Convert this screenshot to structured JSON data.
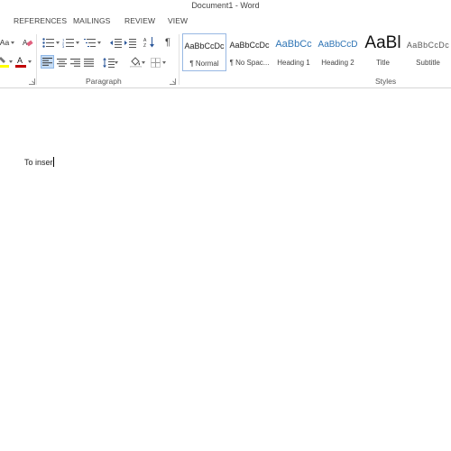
{
  "window": {
    "title": "Document1 - Word"
  },
  "tabs": [
    {
      "label": "REFERENCES"
    },
    {
      "label": "MAILINGS"
    },
    {
      "label": "REVIEW"
    },
    {
      "label": "VIEW"
    }
  ],
  "ribbon": {
    "font_group": {
      "change_case_label": "Aa"
    },
    "paragraph_group": {
      "label": "Paragraph",
      "active_alignment": "left"
    },
    "styles_group": {
      "label": "Styles",
      "items": [
        {
          "sample": "AaBbCcDc",
          "name": "¶ Normal",
          "selected": true,
          "color": "#222222"
        },
        {
          "sample": "AaBbCcDc",
          "name": "¶ No Spac...",
          "selected": false,
          "color": "#222222"
        },
        {
          "sample": "AaBbCc",
          "name": "Heading 1",
          "selected": false,
          "color": "#2e74b5"
        },
        {
          "sample": "AaBbCcD",
          "name": "Heading 2",
          "selected": false,
          "color": "#2e74b5"
        },
        {
          "sample": "AaBl",
          "name": "Title",
          "selected": false,
          "color": "#111111"
        },
        {
          "sample": "AaBbCcDc",
          "name": "Subtitle",
          "selected": false,
          "color": "#5a5a5a"
        }
      ]
    }
  },
  "document": {
    "text": "To inser"
  },
  "colors": {
    "accent": "#2b579a",
    "font_color_bar": "#c00000",
    "highlight_bar": "#ffff00",
    "selection": "#c5dcf5"
  }
}
